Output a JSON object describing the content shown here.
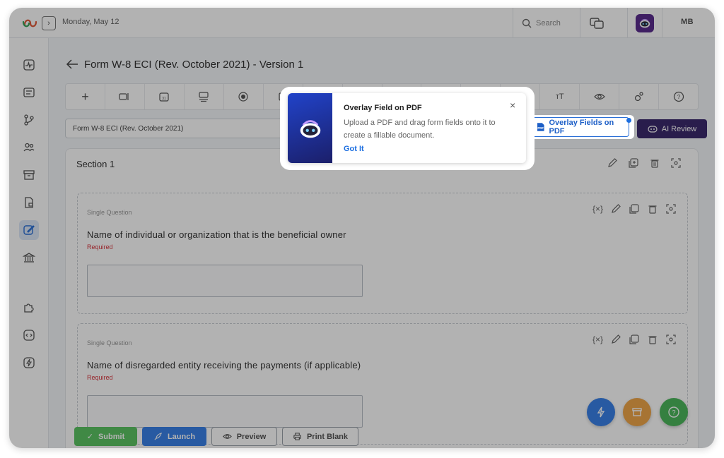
{
  "header": {
    "date": "Monday, May 12",
    "search_placeholder": "Search",
    "user_initials": "MB"
  },
  "page": {
    "title": "Form W-8 ECI (Rev. October 2021) - Version 1",
    "form_select_value": "Form W-8 ECI (Rev. October 2021)",
    "overlay_button": "Overlay Fields on PDF",
    "ai_review_button": "AI Review"
  },
  "section": {
    "title": "Section 1",
    "questions": [
      {
        "kind": "Single Question",
        "label": "Name of individual or organization that is the beneficial owner",
        "required": "Required",
        "variable_icon": "{×}"
      },
      {
        "kind": "Single Question",
        "label": "Name of disregarded entity receiving the payments (if applicable)",
        "required": "Required",
        "variable_icon": "{×}"
      }
    ]
  },
  "bottom_bar": {
    "submit": "Submit",
    "launch": "Launch",
    "preview": "Preview",
    "print_blank": "Print Blank"
  },
  "popover": {
    "title": "Overlay Field on PDF",
    "body": "Upload a PDF and drag form fields onto it to create a fillable document.",
    "action": "Got It",
    "close": "×"
  },
  "colors": {
    "accent_blue": "#1d6fe0",
    "ai_button": "#3c2a6e",
    "submit_green": "#5cc464",
    "launch_blue": "#3a82e8",
    "required_red": "#d9363e",
    "fab_blue": "#3a82e8",
    "fab_orange": "#f0a64a",
    "fab_green": "#4cb85c"
  }
}
